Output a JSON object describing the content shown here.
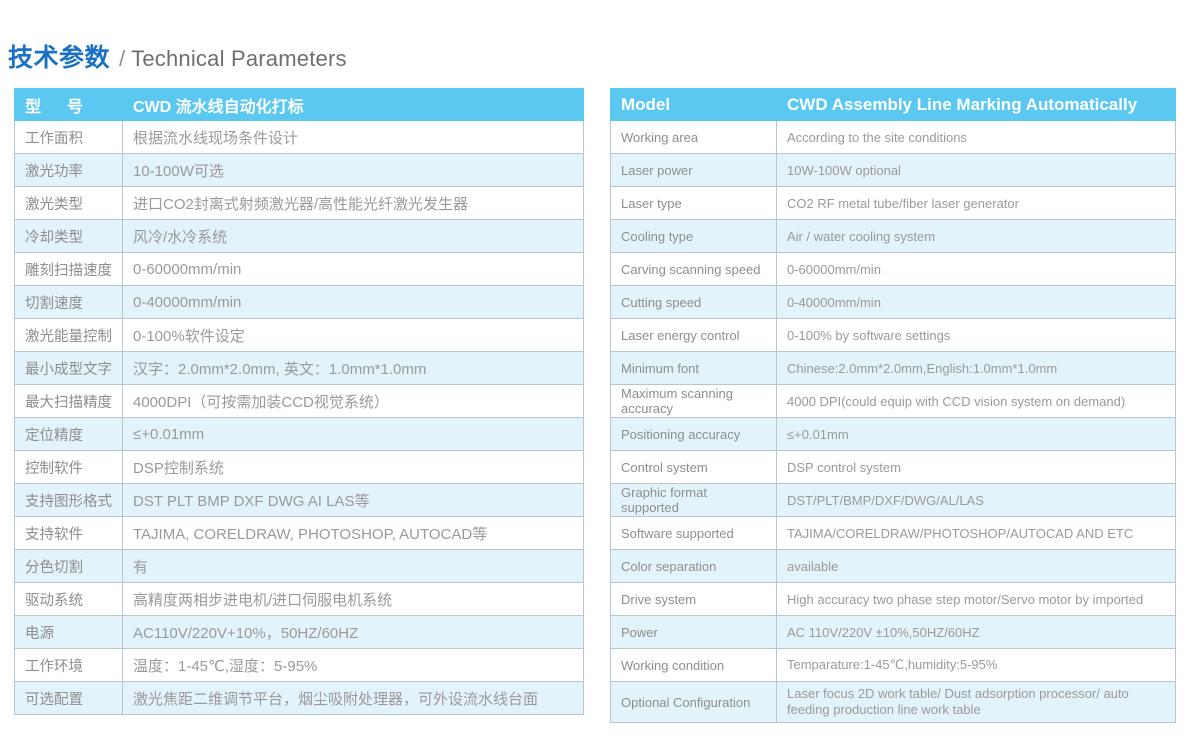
{
  "title": {
    "cn": "技术参数",
    "separator": "/",
    "en": "Technical Parameters"
  },
  "colors": {
    "title_accent": "#1b72c4",
    "title_muted": "#6f6f6f",
    "header_bg": "#5ac8f0",
    "header_text": "#ffffff",
    "row_alt_bg": "#e2f3fb",
    "row_bg": "#ffffff",
    "border": "#b9c6cd",
    "body_text": "#9a9a9a"
  },
  "table_cn": {
    "header": {
      "key": "型　号",
      "value": "CWD 流水线自动化打标"
    },
    "rows": [
      {
        "key": "工作面积",
        "value": "根据流水线现场条件设计"
      },
      {
        "key": "激光功率",
        "value": "10-100W可选"
      },
      {
        "key": "激光类型",
        "value": "进口CO2封离式射频激光器/高性能光纤激光发生器"
      },
      {
        "key": "冷却类型",
        "value": "风冷/水冷系统"
      },
      {
        "key": "雕刻扫描速度",
        "value": "0-60000mm/min"
      },
      {
        "key": "切割速度",
        "value": "0-40000mm/min"
      },
      {
        "key": "激光能量控制",
        "value": "0-100%软件设定"
      },
      {
        "key": "最小成型文字",
        "value": "汉字：2.0mm*2.0mm, 英文：1.0mm*1.0mm"
      },
      {
        "key": "最大扫描精度",
        "value": "4000DPI（可按需加装CCD视觉系统）"
      },
      {
        "key": "定位精度",
        "value": "≤+0.01mm"
      },
      {
        "key": "控制软件",
        "value": "DSP控制系统"
      },
      {
        "key": "支持图形格式",
        "value": "DST PLT BMP DXF DWG AI LAS等"
      },
      {
        "key": "支持软件",
        "value": "TAJIMA, CORELDRAW, PHOTOSHOP, AUTOCAD等"
      },
      {
        "key": "分色切割",
        "value": "有"
      },
      {
        "key": "驱动系统",
        "value": "高精度两相步进电机/进口伺服电机系统"
      },
      {
        "key": "电源",
        "value": "AC110V/220V+10%，50HZ/60HZ"
      },
      {
        "key": "工作环境",
        "value": "温度：1-45℃,湿度：5-95%"
      },
      {
        "key": "可选配置",
        "value": "激光焦距二维调节平台，烟尘吸附处理器，可外设流水线台面"
      }
    ]
  },
  "table_en": {
    "header": {
      "key": "Model",
      "value": "CWD Assembly Line Marking Automatically"
    },
    "rows": [
      {
        "key": "Working area",
        "value": "According to the site conditions"
      },
      {
        "key": "Laser power",
        "value": "10W-100W optional"
      },
      {
        "key": "Laser type",
        "value": "CO2 RF metal tube/fiber laser generator"
      },
      {
        "key": "Cooling type",
        "value": "Air / water cooling system"
      },
      {
        "key": "Carving scanning speed",
        "value": "0-60000mm/min"
      },
      {
        "key": "Cutting speed",
        "value": "0-40000mm/min"
      },
      {
        "key": "Laser energy control",
        "value": "0-100% by software settings"
      },
      {
        "key": "Minimum font",
        "value": "Chinese:2.0mm*2.0mm,English:1.0mm*1.0mm"
      },
      {
        "key": "Maximum scanning accuracy",
        "value": "4000 DPI(could equip with CCD vision system on demand)"
      },
      {
        "key": "Positioning accuracy",
        "value": "≤+0.01mm"
      },
      {
        "key": "Control system",
        "value": "DSP control system"
      },
      {
        "key": "Graphic format supported",
        "value": "DST/PLT/BMP/DXF/DWG/AL/LAS"
      },
      {
        "key": "Software supported",
        "value": "TAJIMA/CORELDRAW/PHOTOSHOP/AUTOCAD AND ETC"
      },
      {
        "key": "Color separation",
        "value": "available"
      },
      {
        "key": "Drive system",
        "value": "High accuracy two phase step motor/Servo motor by imported"
      },
      {
        "key": "Power",
        "value": "AC 110V/220V ±10%,50HZ/60HZ"
      },
      {
        "key": "Working condition",
        "value": "Temparature:1-45℃,humidity:5-95%"
      },
      {
        "key": "Optional Configuration",
        "value": "Laser focus 2D work table/ Dust adsorption processor/ auto feeding production line work table"
      }
    ]
  }
}
